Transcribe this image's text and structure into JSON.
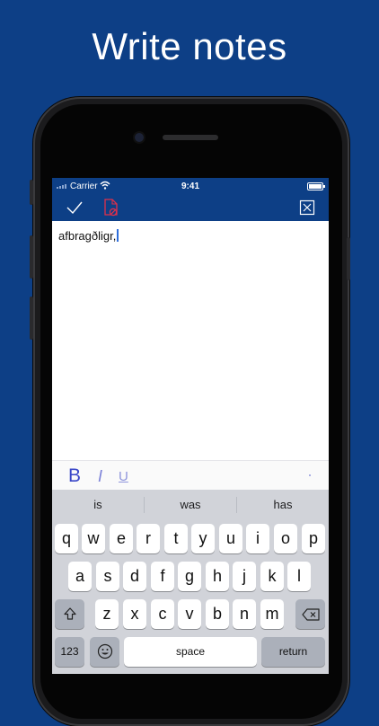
{
  "headline": "Write notes",
  "status_bar": {
    "carrier": "Carrier",
    "time": "9:41"
  },
  "toolbar": {
    "done_icon": "checkmark-icon",
    "delete_icon": "delete-file-icon",
    "close_icon": "close-box-icon"
  },
  "editor": {
    "text": "afbragðligr,"
  },
  "format_bar": {
    "bold": "B",
    "italic": "I",
    "underline": "U"
  },
  "keyboard": {
    "suggestions": [
      "is",
      "was",
      "has"
    ],
    "row1": [
      "q",
      "w",
      "e",
      "r",
      "t",
      "y",
      "u",
      "i",
      "o",
      "p"
    ],
    "row2": [
      "a",
      "s",
      "d",
      "f",
      "g",
      "h",
      "j",
      "k",
      "l"
    ],
    "row3": [
      "z",
      "x",
      "c",
      "v",
      "b",
      "n",
      "m"
    ],
    "numbers_label": "123",
    "space_label": "space",
    "return_label": "return"
  },
  "colors": {
    "brand": "#0d3f86",
    "accent_icon": "#e0304a"
  }
}
